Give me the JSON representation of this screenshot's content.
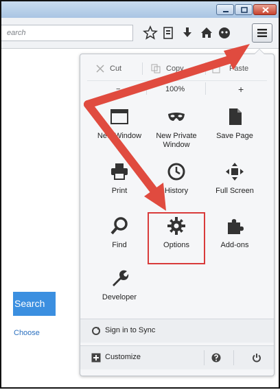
{
  "toolbar": {
    "search_placeholder": "earch"
  },
  "page_content": {
    "search_button": "Search",
    "choose_link": "Choose"
  },
  "menu": {
    "edit": {
      "cut": "Cut",
      "copy": "Copy",
      "paste": "Paste"
    },
    "zoom": {
      "minus": "−",
      "level": "100%",
      "plus": "+"
    },
    "tiles": {
      "new_window": "New Window",
      "new_private_window": "New Private Window",
      "save_page": "Save Page",
      "print": "Print",
      "history": "History",
      "full_screen": "Full Screen",
      "find": "Find",
      "options": "Options",
      "addons": "Add-ons",
      "developer": "Developer"
    },
    "sign_in_sync": "Sign in to Sync",
    "customize": "Customize"
  },
  "colors": {
    "annotation_red": "#e04b3f",
    "search_button_blue": "#3b8fe0"
  }
}
